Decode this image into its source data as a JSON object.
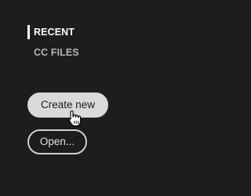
{
  "nav": {
    "items": [
      {
        "label": "RECENT",
        "active": true
      },
      {
        "label": "CC FILES",
        "active": false
      }
    ]
  },
  "actions": {
    "create_new_label": "Create new",
    "open_label": "Open..."
  },
  "colors": {
    "background": "#1d1d1d",
    "primary_button": "#d9d9d9",
    "active_text": "#ffffff",
    "inactive_text": "#b4b4b4"
  },
  "cursor": {
    "icon": "hand-pointer-icon"
  }
}
